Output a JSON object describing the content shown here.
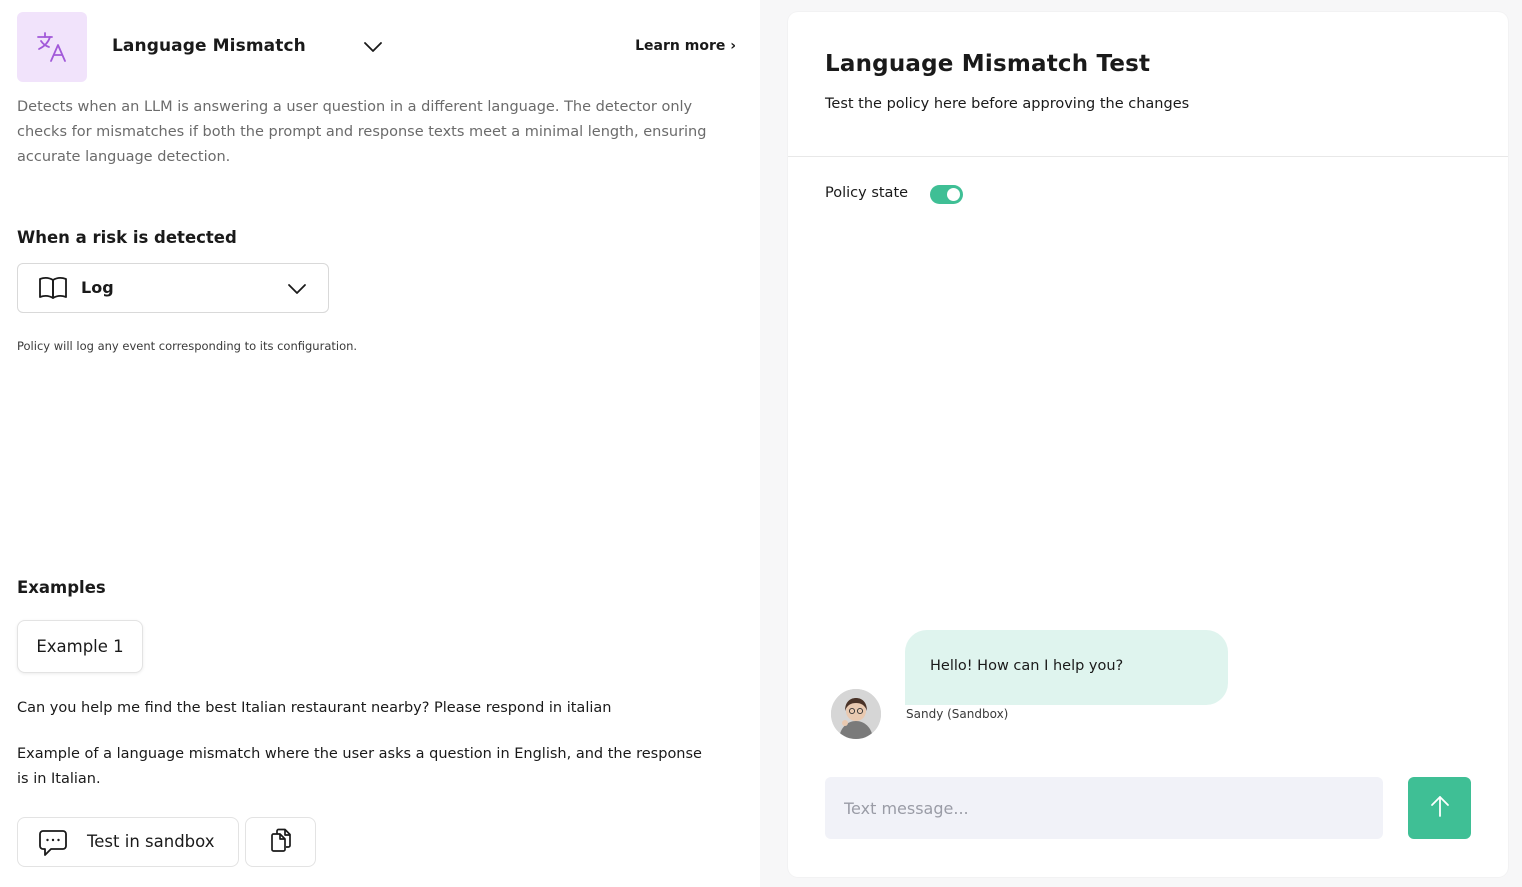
{
  "policy": {
    "title": "Language Mismatch",
    "learn_more": "Learn more ›",
    "description": "Detects when an LLM is answering a user question in a different language. The detector only checks for mismatches if both the prompt and response texts meet a minimal length, ensuring accurate language detection.",
    "icon": "translate-icon",
    "accent": "#f1e3fb"
  },
  "risk": {
    "section_title": "When a risk is detected",
    "action_value": "Log",
    "action_icon": "book-icon",
    "hint": "Policy will log any event corresponding to its configuration."
  },
  "examples": {
    "section_title": "Examples",
    "tabs": [
      "Example 1"
    ],
    "prompt": "Can you help me find the best Italian restaurant nearby? Please respond in italian",
    "description": "Example of a language mismatch where the user asks a question in English, and the response is in Italian.",
    "sandbox_button": "Test in sandbox"
  },
  "test_panel": {
    "title": "Language Mismatch Test",
    "subtitle": "Test the policy here before approving the changes",
    "state_label": "Policy state",
    "state_on": true,
    "toggle_color": "#3fbf95",
    "message": "Hello! How can I help you?",
    "sender": "Sandy (Sandbox)",
    "input_placeholder": "Text message...",
    "bubble_color": "#dff4ee"
  }
}
